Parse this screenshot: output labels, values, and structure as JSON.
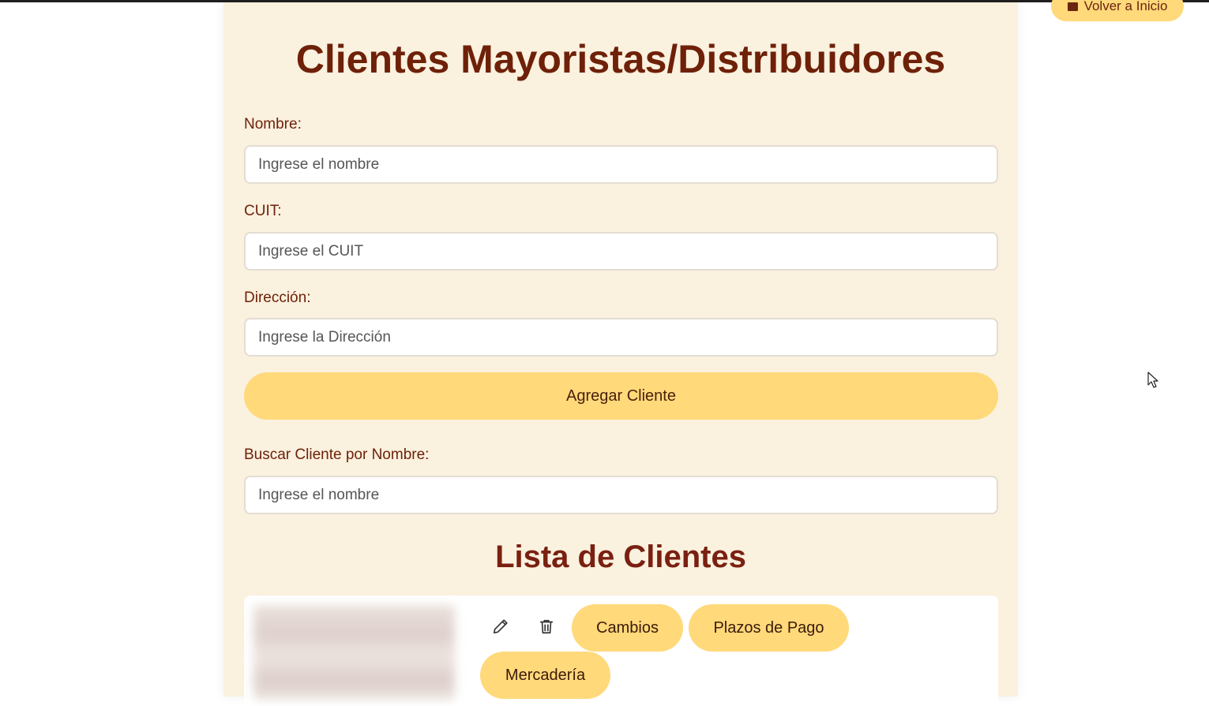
{
  "header": {
    "back_button_label": "Volver a Inicio",
    "title": "Clientes Mayoristas/Distribuidores"
  },
  "form": {
    "name_label": "Nombre:",
    "name_placeholder": "Ingrese el nombre",
    "cuit_label": "CUIT:",
    "cuit_placeholder": "Ingrese el CUIT",
    "address_label": "Dirección:",
    "address_placeholder": "Ingrese la Dirección",
    "submit_label": "Agregar Cliente"
  },
  "search": {
    "label": "Buscar Cliente por Nombre:",
    "placeholder": "Ingrese el nombre"
  },
  "list": {
    "title": "Lista de Clientes",
    "items": [
      {
        "actions": {
          "edit_icon": "pencil-icon",
          "delete_icon": "trash-icon",
          "changes_label": "Cambios",
          "payment_terms_label": "Plazos de Pago",
          "merchandise_label": "Mercadería"
        }
      }
    ]
  },
  "colors": {
    "panel_bg": "#faf1df",
    "accent": "#ffd97a",
    "title_text": "#6e2108"
  }
}
